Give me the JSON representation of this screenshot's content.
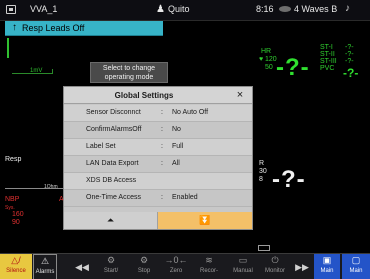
{
  "status_bar": {
    "bed": "VVA_1",
    "patient": "Quito",
    "time": "8:16",
    "waves": "4 Waves",
    "bed_suffix": "B"
  },
  "alarm_banner": {
    "text": "Resp  Leads Off"
  },
  "ecg": {
    "scale": "1mV",
    "hr_label": "HR",
    "hr_high": "120",
    "hr_low": "50",
    "hr_value": "-?-",
    "st_labels": [
      "ST-I",
      "ST-II",
      "ST-III",
      "PVC"
    ],
    "st_values": [
      "-?-",
      "-?-",
      "-?-"
    ],
    "pvc_value": "-?-"
  },
  "mode_box": {
    "line1": "Select to change",
    "line2": "operating mode"
  },
  "resp": {
    "label": "Resp",
    "scale": "1Ohm",
    "rr_label": "R",
    "rr_high": "30",
    "rr_low": "8",
    "rr_value": "-?-"
  },
  "nbp": {
    "label": "NBP",
    "sub": "Sys.",
    "high": "160",
    "low": "90",
    "au": "Au"
  },
  "dialog": {
    "title": "Global Settings",
    "close": "×",
    "rows": [
      {
        "label": "Sensor Disconnct",
        "sep": ":",
        "value": "No Auto Off"
      },
      {
        "label": "ConfirmAlarmsOff",
        "sep": ":",
        "value": "No"
      },
      {
        "label": "Label Set",
        "sep": ":",
        "value": "Full"
      },
      {
        "label": "LAN Data Export",
        "sep": ":",
        "value": "All"
      },
      {
        "label": "XDS DB Access",
        "sep": "",
        "value": ""
      },
      {
        "label": "One-Time Access",
        "sep": ":",
        "value": "Enabled"
      }
    ],
    "up": "⏶",
    "down": "⏬"
  },
  "toolbar": {
    "silence": {
      "icon": "△/",
      "label": "Silence"
    },
    "alarms": {
      "icon": "⚠",
      "label": "Alarms"
    },
    "prev": {
      "icon": "◀◀",
      "label": ""
    },
    "start_stop": {
      "icon": "⚙",
      "label": "Start/"
    },
    "stop": {
      "icon": "⚙",
      "label": "Stop"
    },
    "zero": {
      "icon": "→0←",
      "label": "Zero"
    },
    "record": {
      "icon": "≋",
      "label": "Recor-"
    },
    "manual": {
      "icon": "▭",
      "label": "Manual"
    },
    "monitor": {
      "icon": "⏻",
      "label": "Monitor"
    },
    "next": {
      "icon": "▶▶",
      "label": ""
    },
    "main1": {
      "icon": "▣",
      "label": "Main"
    },
    "main2": {
      "icon": "▢",
      "label": "Main"
    }
  },
  "colors": {
    "banner": "#37b3c7",
    "ecg": "#30e030",
    "nbp": "#e03030",
    "silence": "#e8c840",
    "main": "#2454c8",
    "dialog_nav_active": "#f4c068"
  }
}
